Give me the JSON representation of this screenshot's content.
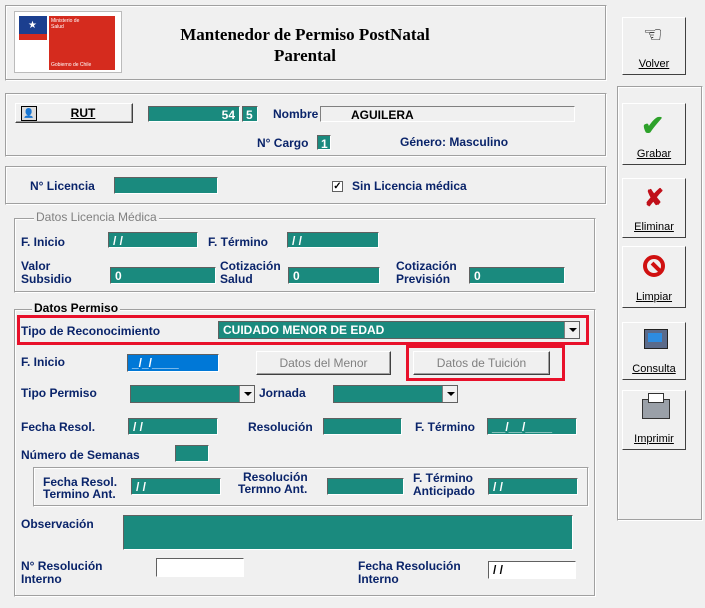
{
  "header": {
    "logo_line1": "Ministerio de",
    "logo_line2": "Salud",
    "logo_line3": "Gobierno de Chile",
    "title": "Mantenedor de Permiso PostNatal Parental"
  },
  "sidebar": {
    "volver": "Volver",
    "grabar": "Grabar",
    "eliminar": "Eliminar",
    "limpiar": "Limpiar",
    "consulta": "Consulta",
    "imprimir": "Imprimir"
  },
  "rut_section": {
    "rut_button": "RUT",
    "rut_number": "54",
    "rut_dv": "5",
    "nombre_label": "Nombre",
    "nombre_value": "AGUILERA",
    "cargo_label": "N° Cargo",
    "cargo_value": "1",
    "genero": "Género: Masculino"
  },
  "licencia": {
    "label": "N° Licencia",
    "value": "",
    "sin_licencia_label": "Sin Licencia médica",
    "sin_licencia_checked": true
  },
  "datos_licencia": {
    "group_title": "Datos Licencia Médica",
    "f_inicio_label": "F. Inicio",
    "f_inicio_value": "/ /",
    "f_termino_label": "F. Término",
    "f_termino_value": "/ /",
    "valor_subsidio_label1": "Valor",
    "valor_subsidio_label2": "Subsidio",
    "valor_subsidio_value": "0",
    "cot_salud_label1": "Cotización",
    "cot_salud_label2": "Salud",
    "cot_salud_value": "0",
    "cot_prev_label1": "Cotización",
    "cot_prev_label2": "Previsión",
    "cot_prev_value": "0"
  },
  "datos_permiso": {
    "group_title": "Datos Permiso",
    "tipo_reconocimiento_label": "Tipo de Reconocimiento",
    "tipo_reconocimiento_value": "CUIDADO MENOR DE EDAD",
    "f_inicio_label": "F. Inicio",
    "f_inicio_value": "_/_/____",
    "datos_menor_button": "Datos del Menor",
    "datos_tuicion_button": "Datos de Tuición",
    "tipo_permiso_label": "Tipo Permiso",
    "tipo_permiso_value": "",
    "jornada_label": "Jornada",
    "jornada_value": "",
    "fecha_resol_label": "Fecha Resol.",
    "fecha_resol_value": "/ /",
    "resolucion_label": "Resolución",
    "resolucion_value": "",
    "f_termino_label": "F. Término",
    "f_termino_value": "__/__/____",
    "num_semanas_label": "Número de Semanas",
    "num_semanas_value": "",
    "fecha_resol_ant_label1": "Fecha Resol.",
    "fecha_resol_ant_label2": "Termino Ant.",
    "fecha_resol_ant_value": "/ /",
    "resol_term_ant_label1": "Resolución",
    "resol_term_ant_label2": "Termno Ant.",
    "resol_term_ant_value": "",
    "f_term_anticipado_label1": "F. Término",
    "f_term_anticipado_label2": "Anticipado",
    "f_term_anticipado_value": "/ /",
    "observacion_label": "Observación",
    "observacion_value": "",
    "nro_resol_interno_label1": "N° Resolución",
    "nro_resol_interno_label2": "Interno",
    "nro_resol_interno_value": "",
    "fecha_resol_interno_label1": "Fecha Resolución",
    "fecha_resol_interno_label2": "Interno",
    "fecha_resol_interno_value": "/ /"
  },
  "colors": {
    "field": "#1a8a7e",
    "label": "#0a246a",
    "highlight": "#e8102a"
  }
}
